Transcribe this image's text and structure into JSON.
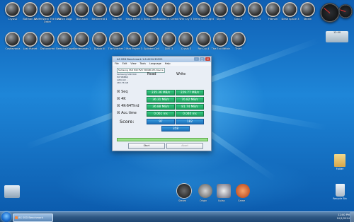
{
  "window": {
    "title": "AS SSD Benchmark 1.6.4194.30325",
    "menu": [
      "File",
      "Edit",
      "View",
      "Tools",
      "Language",
      "Help"
    ],
    "drive": "Samsung SSD 840 EVO 500GB ATA Device",
    "info": [
      "Samsung SSD 840",
      "EXT0BB6Q",
      "iaStorAC - ",
      "",
      "465.76 GB"
    ],
    "col_read": "Read",
    "col_write": "Write",
    "rows": [
      {
        "label": "Seq",
        "read": "235.36 MB/s",
        "write": "229.77 MB/s"
      },
      {
        "label": "4K",
        "read": "36.31 MB/s",
        "write": "76.82 MB/s"
      },
      {
        "label": "4K-64Thrd",
        "read": "36.88 MB/s",
        "write": "81.74 MB/s"
      },
      {
        "label": "Acc.time",
        "read": "0.061 ms",
        "write": "0.040 ms"
      }
    ],
    "score_label": "Score:",
    "score_read": "97",
    "score_write": "182",
    "score_total": "358",
    "start_button": "Start",
    "abort_button": "Abort",
    "progress": 1.0
  },
  "desktop_icons_row1": [
    "Crysis2",
    "Batman AA",
    "Wolfenstein The New Order",
    "Watch Dogs",
    "BioShock",
    "Battlefield 4",
    "Titanfall",
    "Mass Effect 3",
    "Tomb Raider",
    "Assassin's Creed IV",
    "Far Cry 3",
    "Metro Last Light",
    "Skyrim",
    "Grid 2",
    "F1 2013",
    "Hitman",
    "Dead Space 3",
    "Steam"
  ],
  "desktop_icons_row2": [
    "Castlevania",
    "Lost Planet",
    "Dishonored",
    "Sleeping Dogs",
    "Borderlands 2",
    "Diablo III",
    "The Witcher 2",
    "Max Payne 3",
    "Splinter Cell",
    "DiRT 3",
    "Crysis 3",
    "Far Cry 4",
    "The Evil Within",
    "Thief"
  ],
  "gadgets": {
    "clock_text": "12:00"
  },
  "right_icons": [
    "Folder",
    "Recycle Bin"
  ],
  "dock_labels": [
    "Steam",
    "Origin",
    "Uplay",
    "Game"
  ],
  "taskbar": {
    "task_label": "AS SSD Benchmark",
    "time": "12:00 PM",
    "date": "10/1/2014"
  }
}
